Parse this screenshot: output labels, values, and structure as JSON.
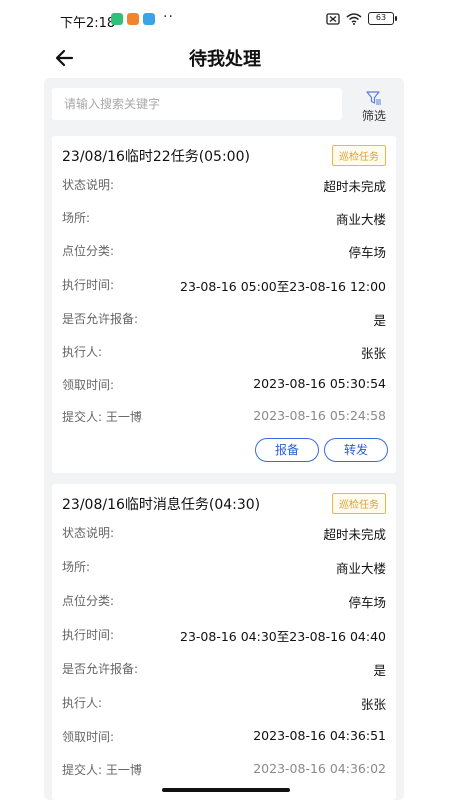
{
  "status_bar": {
    "time": "下午2:18",
    "more": "··",
    "battery": "63",
    "app_colors": [
      "#2fc07a",
      "#f0852d",
      "#3ba4e6"
    ]
  },
  "header": {
    "title": "待我处理",
    "back_icon": "arrow-left-icon"
  },
  "search": {
    "placeholder": "请输入搜索关键字",
    "filter_label": "筛选",
    "filter_icon": "filter-icon"
  },
  "labels": {
    "status": "状态说明:",
    "place": "场所:",
    "category": "点位分类:",
    "exec_time": "执行时间:",
    "allow_report": "是否允许报备:",
    "executor": "执行人:",
    "claim_time": "领取时间:"
  },
  "tasks": [
    {
      "title": "23/08/16临时22任务(05:00)",
      "badge": "巡检任务",
      "status": "超时未完成",
      "place": "商业大楼",
      "category": "停车场",
      "exec_time": "23-08-16 05:00至23-08-16 12:00",
      "allow_report": "是",
      "executor": "张张",
      "claim_time": "2023-08-16 05:30:54",
      "submitter": "提交人: 王一博",
      "submit_time": "2023-08-16 05:24:58",
      "report_btn": "报备",
      "forward_btn": "转发"
    },
    {
      "title": "23/08/16临时消息任务(04:30)",
      "badge": "巡检任务",
      "status": "超时未完成",
      "place": "商业大楼",
      "category": "停车场",
      "exec_time": "23-08-16 04:30至23-08-16 04:40",
      "allow_report": "是",
      "executor": "张张",
      "claim_time": "2023-08-16 04:36:51",
      "submitter": "提交人: 王一博",
      "submit_time": "2023-08-16 04:36:02"
    }
  ],
  "colors": {
    "accent": "#2a5cd6",
    "badge": "#d9a23c",
    "background": "#f2f3f5"
  }
}
